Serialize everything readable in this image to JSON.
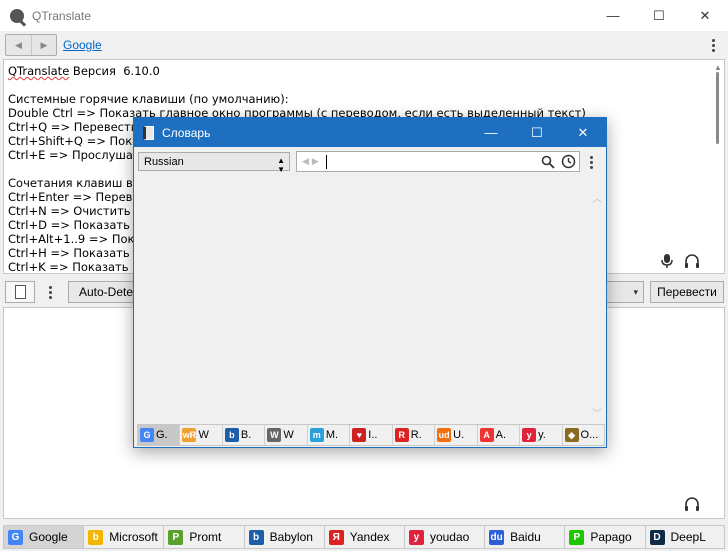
{
  "window": {
    "title": "QTranslate",
    "controls": {
      "minimize": "—",
      "maximize": "☐",
      "close": "✕"
    }
  },
  "toolbar": {
    "back": "◀",
    "forward": "▶",
    "service_link": "Google"
  },
  "source": {
    "lines": [
      "QTranslate Версия  6.10.0",
      "",
      "Системные горячие клавиши (по умолчанию):",
      "Double Ctrl => Показать главное окно программы (с переводом, если есть выделенный текст)",
      "Ctrl+Q => Перевести",
      "Ctrl+Shift+Q => Показ",
      "Ctrl+E => Прослушать",
      "",
      "Сочетания клавиш в п",
      "Ctrl+Enter => Переве",
      "Ctrl+N => Очистить т",
      "Ctrl+D => Показать сл",
      "Ctrl+Alt+1..9 => Пока",
      "Ctrl+H => Показать ис",
      "Ctrl+K => Показать ви"
    ],
    "first_word": "QTranslate",
    "first_rest": " Версия  6.10.0"
  },
  "midbar": {
    "source_lang": "Auto-Detect",
    "translate_label": "Перевести",
    "dropdown_arrow": "▾"
  },
  "tabs": [
    {
      "label": "Google",
      "icon": "google-icon",
      "glyph": "G",
      "color": "#4285f4",
      "active": true
    },
    {
      "label": "Microsoft",
      "icon": "bing-icon",
      "glyph": "b",
      "color": "#f2b600",
      "active": false
    },
    {
      "label": "Promt",
      "icon": "promt-icon",
      "glyph": "P",
      "color": "#5aa02c",
      "active": false
    },
    {
      "label": "Babylon",
      "icon": "babylon-icon",
      "glyph": "b",
      "color": "#1c5ea8",
      "active": false
    },
    {
      "label": "Yandex",
      "icon": "yandex-icon",
      "glyph": "Я",
      "color": "#d22",
      "active": false
    },
    {
      "label": "youdao",
      "icon": "youdao-icon",
      "glyph": "y",
      "color": "#e1223c",
      "active": false
    },
    {
      "label": "Baidu",
      "icon": "baidu-icon",
      "glyph": "du",
      "color": "#2b5fd9",
      "active": false
    },
    {
      "label": "Papago",
      "icon": "papago-icon",
      "glyph": "P",
      "color": "#1ec800",
      "active": false
    },
    {
      "label": "DeepL",
      "icon": "deepl-icon",
      "glyph": "D",
      "color": "#0f2b46",
      "active": false
    }
  ],
  "dictionary": {
    "title": "Словарь",
    "language": "Russian",
    "search_value": "",
    "tabs": [
      {
        "label": "G.",
        "icon": "google-icon",
        "glyph": "G",
        "color": "#4285f4",
        "active": true
      },
      {
        "label": "W",
        "icon": "wordreference-icon",
        "glyph": "wR",
        "color": "#f0a030",
        "active": false
      },
      {
        "label": "B.",
        "icon": "babylon-icon",
        "glyph": "b",
        "color": "#1c5ea8",
        "active": false
      },
      {
        "label": "W",
        "icon": "wikipedia-icon",
        "glyph": "W",
        "color": "#666",
        "active": false
      },
      {
        "label": "M.",
        "icon": "multitran-icon",
        "glyph": "m",
        "color": "#2aa0d8",
        "active": false
      },
      {
        "label": "I..",
        "icon": "ineedict-icon",
        "glyph": "♥",
        "color": "#c22",
        "active": false
      },
      {
        "label": "R.",
        "icon": "reverso-icon",
        "glyph": "R",
        "color": "#d22",
        "active": false
      },
      {
        "label": "U.",
        "icon": "urbandictionary-icon",
        "glyph": "ud",
        "color": "#f07010",
        "active": false
      },
      {
        "label": "A.",
        "icon": "abbyy-icon",
        "glyph": "A",
        "color": "#e33",
        "active": false
      },
      {
        "label": "y.",
        "icon": "youdao-icon",
        "glyph": "y",
        "color": "#e1223c",
        "active": false
      },
      {
        "label": "O...",
        "icon": "other-icon",
        "glyph": "◆",
        "color": "#8a6a20",
        "active": false
      }
    ]
  }
}
